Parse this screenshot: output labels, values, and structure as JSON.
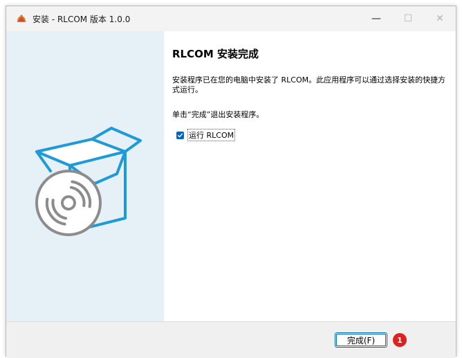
{
  "window": {
    "title": "安装 - RLCOM 版本 1.0.0",
    "controls": {
      "minimize": "—",
      "maximize": "☐",
      "close": "✕"
    }
  },
  "page": {
    "heading": "RLCOM 安装完成",
    "description": "安装程序已在您的电脑中安装了 RLCOM。此应用程序可以通过选择安装的快捷方式运行。",
    "hint": "单击“完成”退出安装程序。",
    "run_checkbox": {
      "label": "运行 RLCOM",
      "checked": true
    }
  },
  "footer": {
    "finish_label": "完成(F)",
    "step_badge": "1"
  },
  "colors": {
    "accent": "#0067c0",
    "side_panel": "#e6f0f7",
    "art_blue": "#1f9ad8",
    "badge": "#e02020"
  }
}
